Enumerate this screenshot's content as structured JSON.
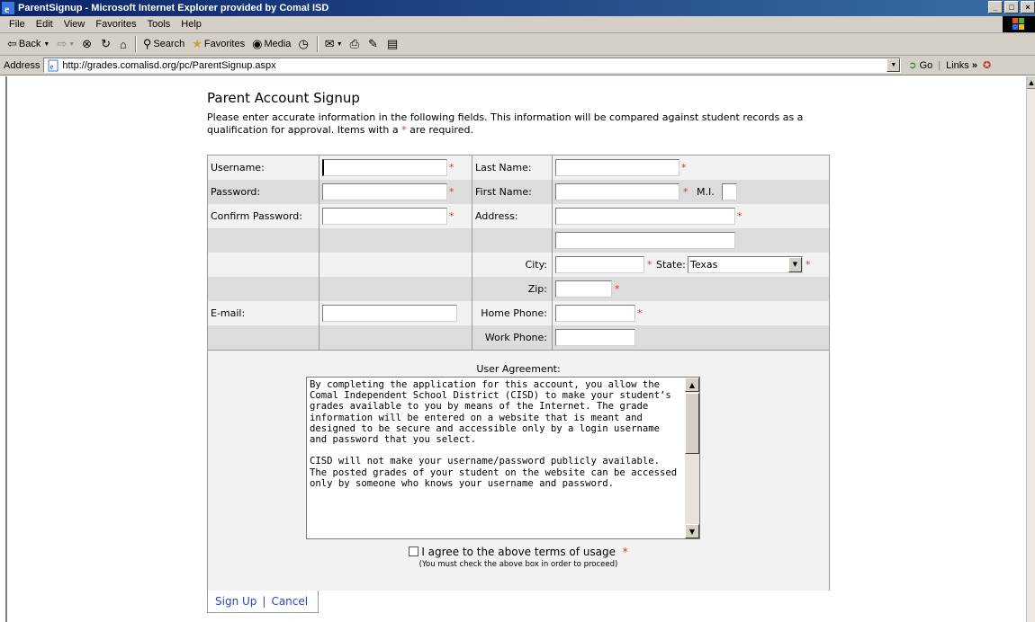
{
  "window": {
    "title": "ParentSignup - Microsoft Internet Explorer provided by Comal ISD",
    "controls": [
      "_",
      "□",
      "×"
    ]
  },
  "menu": [
    "File",
    "Edit",
    "View",
    "Favorites",
    "Tools",
    "Help"
  ],
  "toolbar": {
    "back": "Back",
    "search": "Search",
    "favorites": "Favorites",
    "media": "Media"
  },
  "address": {
    "label": "Address",
    "url": "http://grades.comalisd.org/pc/ParentSignup.aspx",
    "go": "Go",
    "links": "Links"
  },
  "page": {
    "title": "Parent Account Signup",
    "intro_before": "Please enter accurate information in the following fields.  This information will be compared against student records as a qualification for approval.  Items with a ",
    "intro_star": "*",
    "intro_after": " are required."
  },
  "form": {
    "username_label": "Username:",
    "password_label": "Password:",
    "confirm_label": "Confirm Password:",
    "email_label": "E-mail:",
    "lastname_label": "Last Name:",
    "firstname_label": "First Name:",
    "mi_label": "M.I.",
    "address_label": "Address:",
    "city_label": "City:",
    "state_label": "State:",
    "state_value": "Texas",
    "zip_label": "Zip:",
    "homephone_label": "Home Phone:",
    "workphone_label": "Work Phone:",
    "required_mark": "*"
  },
  "agreement": {
    "label": "User Agreement:",
    "text": "By completing the application for this account, you allow the Comal Independent School District (CISD) to make your student’s grades available to you by means of the Internet. The grade information will be entered on a website that is meant and designed to be secure and accessible only by a login username and password that you select.\n\nCISD will not make your username/password publicly available. The posted grades of your student on the website can be accessed only by someone who knows your username and password.",
    "checkbox_label": "I agree to the above terms of usage",
    "note": "(You must check the above box in order to proceed)"
  },
  "actions": {
    "signup": "Sign Up",
    "separator": "|",
    "cancel": "Cancel"
  }
}
